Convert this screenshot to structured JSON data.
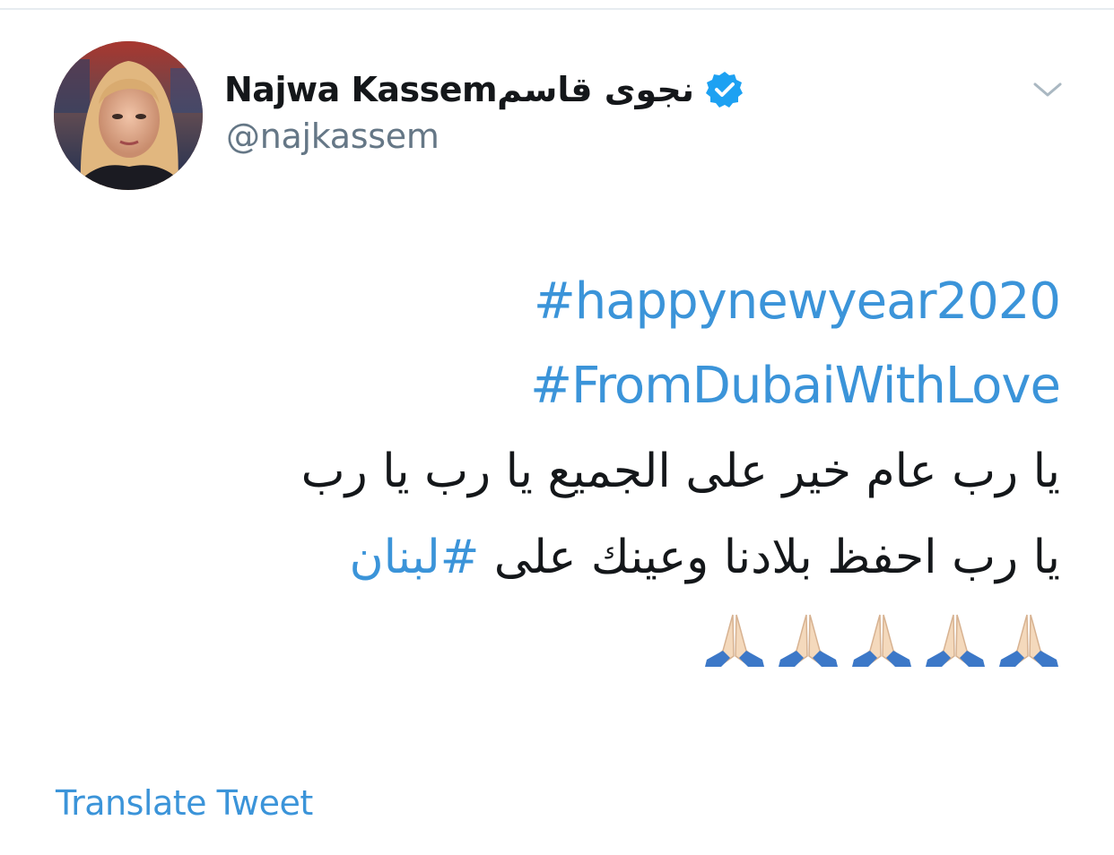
{
  "tweet": {
    "author": {
      "display_name": "Najwa Kassemنجوى قاسم",
      "handle": "@najkassem",
      "verified": true,
      "avatar": "avatar-photo"
    },
    "menu_icon": "chevron-down-icon",
    "hashtags": [
      "#happynewyear2020",
      "#FromDubaiWithLove"
    ],
    "arabic_line_1": "يا رب عام خير على الجميع يا رب يا رب",
    "arabic_line_2_text": "يا رب احفظ بلادنا وعينك على ",
    "arabic_line_2_tag": "#لبنان",
    "emoji": [
      "folded-hands-icon",
      "folded-hands-icon",
      "folded-hands-icon",
      "folded-hands-icon",
      "folded-hands-icon"
    ],
    "translate_label": "Translate Tweet"
  },
  "colors": {
    "link": "#3b94d9",
    "verified": "#1da1f2",
    "handle": "#657786",
    "text": "#14171a",
    "divider": "#e6ecf0"
  }
}
